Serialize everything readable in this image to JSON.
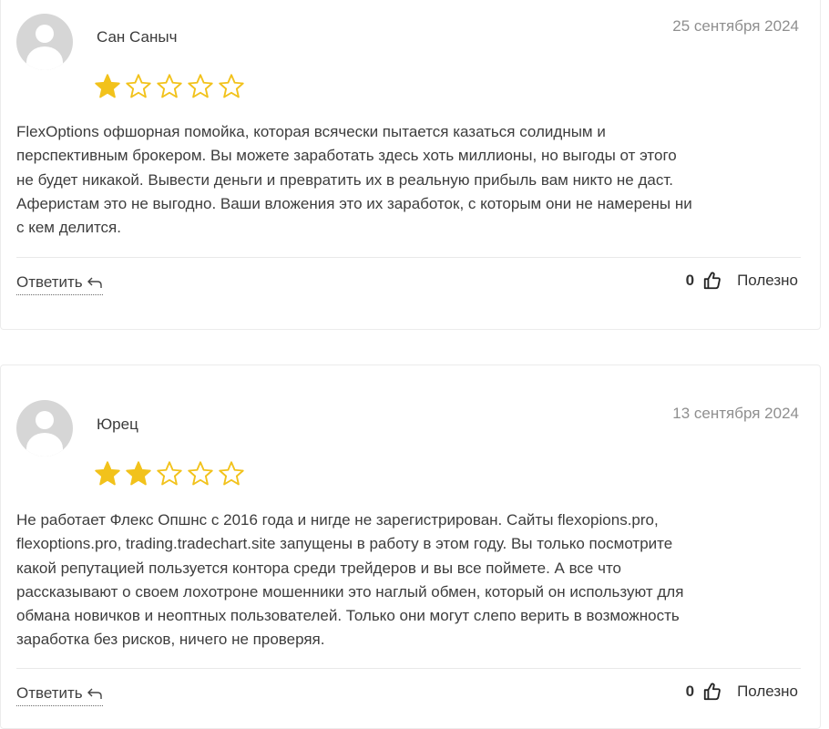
{
  "reviews": [
    {
      "author": "Сан Саныч",
      "date": "25 сентября 2024",
      "rating": 1,
      "max_rating": 5,
      "text_lines": [
        "FlexOptions офшорная помойка, которая всячески пытается казаться солидным и",
        "перспективным брокером. Вы можете заработать здесь хоть миллионы, но выгоды от этого",
        "не будет никакой. Вывести деньги и превратить их в реальную прибыль вам никто не даст.",
        "Аферистам это не выгодно. Ваши вложения это их заработок, с которым они не намерены ни",
        "с кем делится."
      ],
      "reply_label": "Ответить",
      "likes": "0",
      "useful_label": "Полезно"
    },
    {
      "author": "Юрец",
      "date": "13 сентября 2024",
      "rating": 2,
      "max_rating": 5,
      "text_lines": [
        "Не работает Флекс Опшнс с 2016 года и нигде не зарегистрирован. Сайты flexopions.pro,",
        "flexoptions.pro, trading.tradechart.site запущены в работу в этом году. Вы только посмотрите",
        "какой репутацией пользуется контора среди трейдеров и вы все поймете. А все что",
        "рассказывают о своем лохотроне мошенники это наглый обмен, который он используют для",
        "обмана новичков и неоптных пользователей. Только они могут слепо верить в возможность",
        "заработка без рисков, ничего не проверяя."
      ],
      "reply_label": "Ответить",
      "likes": "0",
      "useful_label": "Полезно"
    }
  ],
  "colors": {
    "star_filled": "#f2c21b",
    "star_empty_stroke": "#f2c21b"
  },
  "icons": {
    "avatar": "user-avatar-icon",
    "reply": "reply-arrow-icon",
    "like": "thumbs-up-icon",
    "star": "star-icon"
  }
}
